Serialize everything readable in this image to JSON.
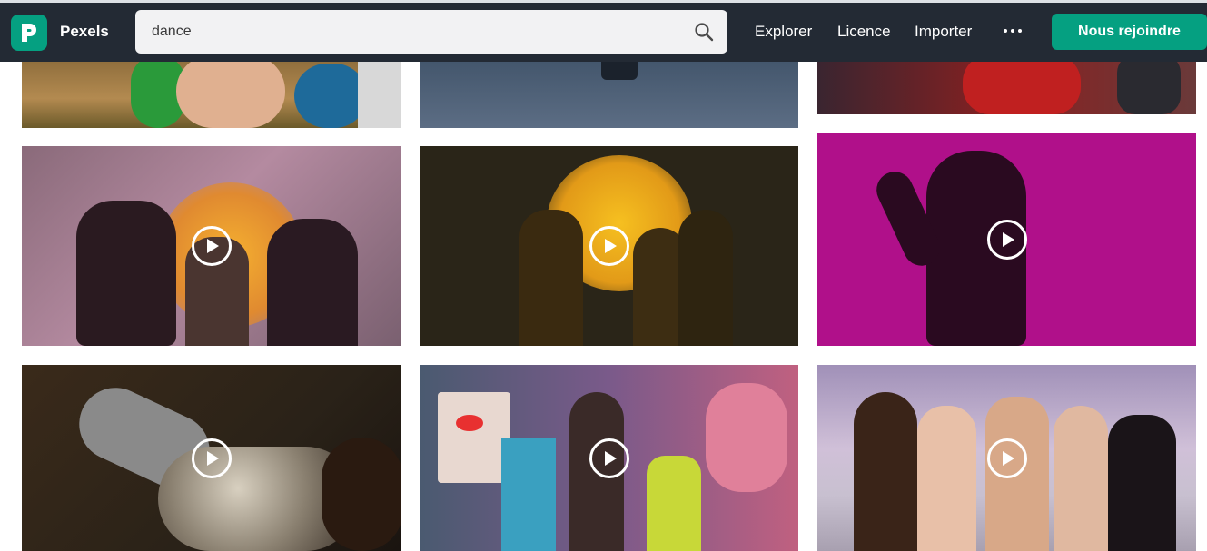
{
  "brand": {
    "name": "Pexels",
    "accent": "#05a081",
    "nav_bg": "#232a34"
  },
  "search": {
    "value": "dance",
    "icon": "search-icon"
  },
  "nav": {
    "links": [
      "Explorer",
      "Licence",
      "Importer"
    ],
    "more_icon": "more-horizontal-icon",
    "join_label": "Nous rejoindre"
  },
  "videos": [
    {
      "theme": "feathered carnival dancer",
      "has_play": false
    },
    {
      "theme": "dancer on blue floor",
      "has_play": false
    },
    {
      "theme": "dancers in red",
      "has_play": false
    },
    {
      "theme": "women dancing near orange sun with branches",
      "has_play": true
    },
    {
      "theme": "shadows dancing on yellow wall",
      "has_play": true
    },
    {
      "theme": "silhouette dancing on magenta background",
      "has_play": true
    },
    {
      "theme": "glitter covered body",
      "has_play": true
    },
    {
      "theme": "dancers in neon room",
      "has_play": true
    },
    {
      "theme": "women dancing on beach at dusk",
      "has_play": true
    }
  ]
}
